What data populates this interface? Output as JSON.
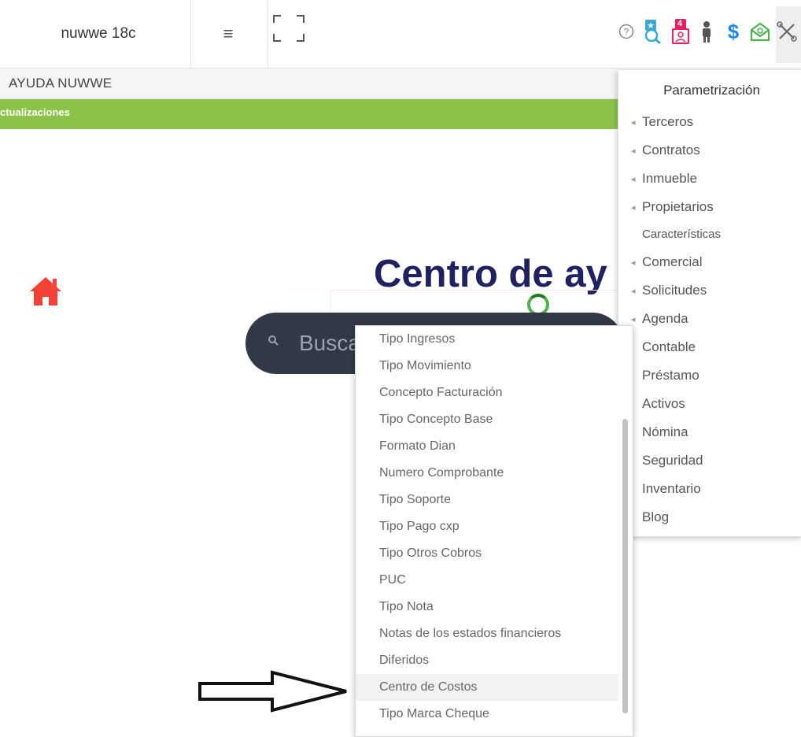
{
  "header": {
    "brand": "nuwwe 18c",
    "menu_icon": "≡",
    "icons": {
      "help": "help-icon",
      "search_star": "search-star-icon",
      "contacts_badge": "4",
      "person": "person-icon",
      "dollar": "$",
      "mail": "mail-icon",
      "tools": "tools-icon"
    }
  },
  "ayuda": {
    "title": "AYUDA NUWWE"
  },
  "green_bar": {
    "text": "ctualizaciones"
  },
  "main": {
    "title": "Centro de ay",
    "search_placeholder": "Busca"
  },
  "param_menu": {
    "title": "Parametrización",
    "items": [
      {
        "label": "Terceros",
        "caret": "◂"
      },
      {
        "label": "Contratos",
        "caret": "◂"
      },
      {
        "label": "Inmueble",
        "caret": "◂"
      },
      {
        "label": "Propietarios",
        "caret": "◂"
      },
      {
        "label": "Características",
        "caret": ""
      },
      {
        "label": "Comercial",
        "caret": "◂"
      },
      {
        "label": "Solicitudes",
        "caret": "◂"
      },
      {
        "label": "Agenda",
        "caret": "◂"
      },
      {
        "label": "Contable",
        "caret": "|"
      },
      {
        "label": "Préstamo",
        "caret": "|"
      },
      {
        "label": "Activos",
        "caret": "|"
      },
      {
        "label": "Nómina",
        "caret": "|"
      },
      {
        "label": "Seguridad",
        "caret": "|"
      },
      {
        "label": "Inventario",
        "caret": "|"
      },
      {
        "label": "Blog",
        "caret": "|"
      }
    ]
  },
  "contable_submenu": {
    "items": [
      "Tipo Ingresos",
      "Tipo Movimiento",
      "Concepto Facturación",
      "Tipo Concepto Base",
      "Formato Dian",
      "Numero Comprobante",
      "Tipo Soporte",
      "Tipo Pago cxp",
      "Tipo Otros Cobros",
      "PUC",
      "Tipo Nota",
      "Notas de los estados financieros",
      "Diferidos",
      "Centro de Costos",
      "Tipo Marca Cheque"
    ],
    "highlighted": "Centro de Costos"
  },
  "colors": {
    "green_bar": "#8bc34a",
    "title": "#1f2160",
    "search_bg": "#333847",
    "home": "#f44336"
  }
}
